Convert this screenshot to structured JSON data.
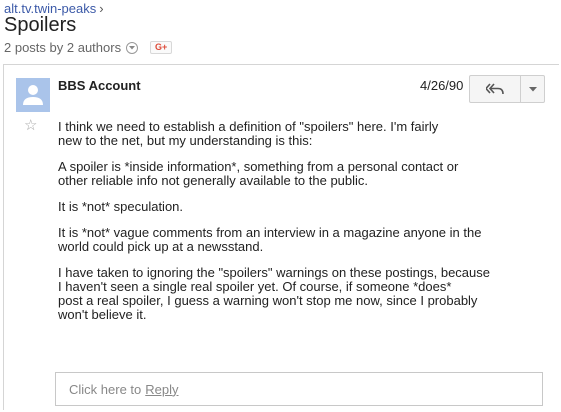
{
  "breadcrumb": {
    "group": "alt.tv.twin-peaks",
    "separator": "›"
  },
  "thread": {
    "title": "Spoilers",
    "summary": "2 posts by 2 authors",
    "share_label": "G+"
  },
  "post": {
    "author": "BBS Account",
    "date": "4/26/90",
    "paragraphs": [
      "I think we need to establish a definition of \"spoilers\" here.  I'm fairly\nnew to the net, but my understanding is this:",
      "A spoiler is *inside information*, something from a personal contact or\nother reliable info not generally available to the public.",
      "It is *not* speculation.",
      "It is *not* vague comments from an interview in a magazine anyone in the\nworld could pick up at a newsstand.",
      "I have taken to ignoring the \"spoilers\" warnings on these postings, because\nI haven't seen a single real spoiler yet.  Of course, if someone *does*\npost a real spoiler, I guess a warning won't stop me now, since I probably\nwon't believe it."
    ]
  },
  "reply_box": {
    "prompt": "Click here to",
    "link": "Reply"
  },
  "icons": {
    "avatar": "person-icon",
    "star": "star-icon",
    "reply": "reply-all-icon",
    "more": "chevron-down-icon"
  },
  "colors": {
    "link": "#3c5aa8",
    "avatar_bg": "#aac4ea",
    "gplus": "#dd4b39"
  }
}
